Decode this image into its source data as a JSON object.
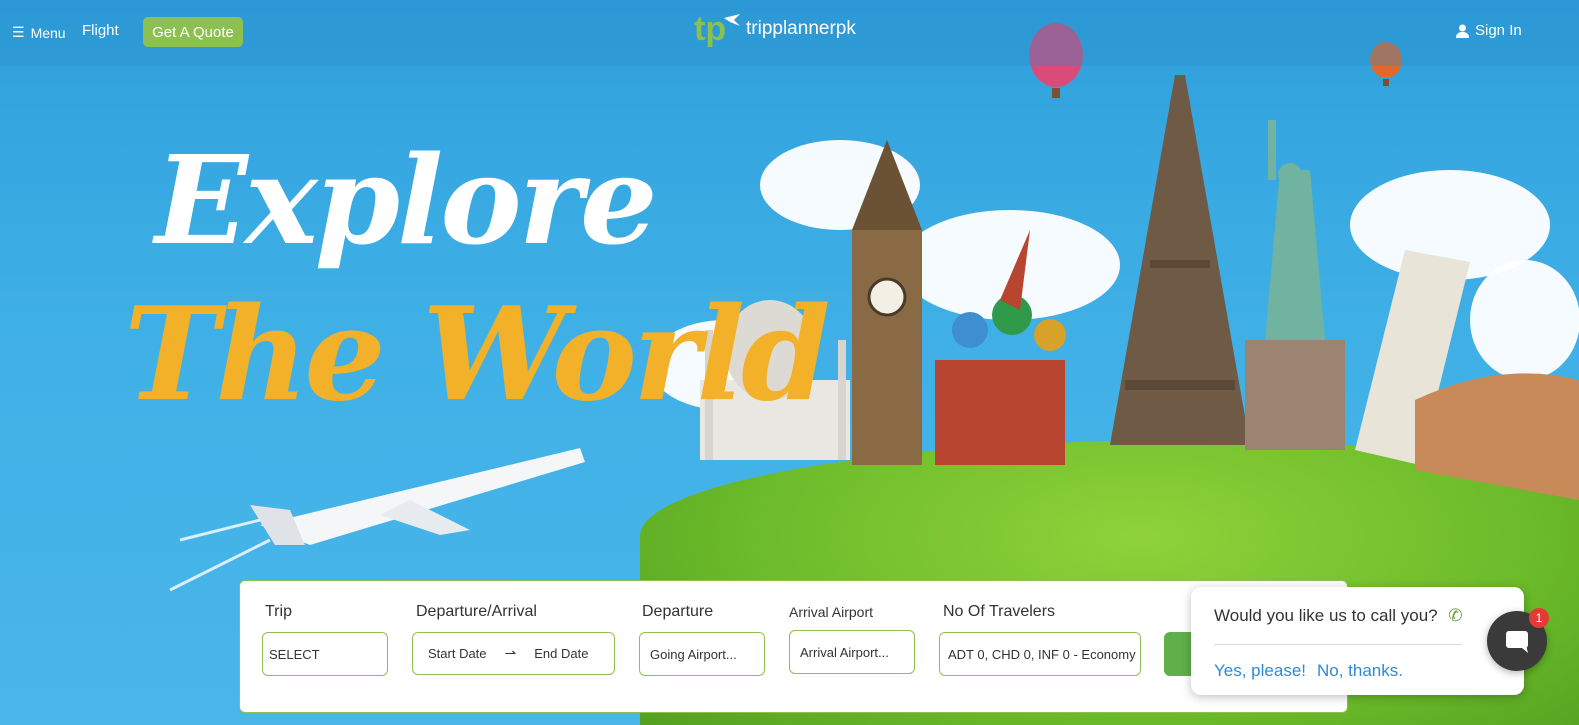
{
  "nav": {
    "menu_label": "Menu",
    "flight_label": "Flight",
    "quote_label": "Get A Quote",
    "signin_label": "Sign In"
  },
  "logo": {
    "text": "tripplannerpk"
  },
  "hero": {
    "line1": "Explore",
    "line2": "The World"
  },
  "search": {
    "trip_label": "Trip",
    "trip_value": "SELECT",
    "dates_label": "Departure/Arrival",
    "start_placeholder": "Start Date",
    "end_placeholder": "End Date",
    "departure_label": "Departure",
    "departure_placeholder": "Going Airport...",
    "arrival_label": "Arrival Airport",
    "arrival_placeholder": "Arrival Airport...",
    "travelers_label": "No Of Travelers",
    "travelers_value": "ADT 0, CHD 0, INF 0 - Economy"
  },
  "callback": {
    "question": "Would you like us to call you?",
    "yes_label": "Yes, please!",
    "no_label": "No, thanks."
  },
  "chat": {
    "badge": "1"
  },
  "colors": {
    "accent_green": "#8cc152",
    "sky_blue": "#3aa6df",
    "headline_yellow": "#f2b128",
    "link_blue": "#2d8ad8"
  }
}
